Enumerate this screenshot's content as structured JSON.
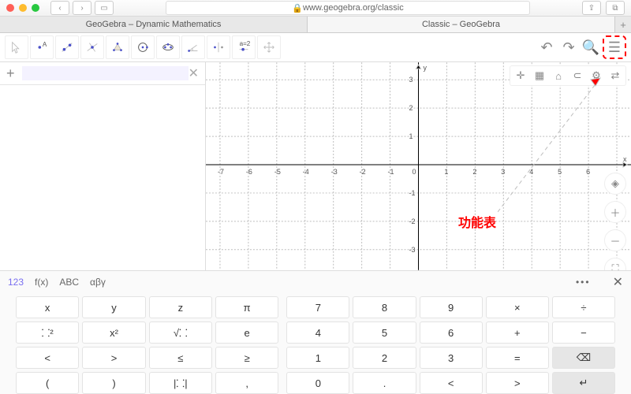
{
  "url": "www.geogebra.org/classic",
  "tabs": [
    "GeoGebra – Dynamic Mathematics",
    "Classic – GeoGebra"
  ],
  "toolbar": [
    "cursor",
    "point",
    "line",
    "perp",
    "poly",
    "circle",
    "ellipse",
    "angle",
    "reflect",
    "slider",
    "move"
  ],
  "right": [
    "undo",
    "redo",
    "search",
    "menu"
  ],
  "input_ph": "",
  "viewbar": [
    "axes",
    "grid",
    "home",
    "snap",
    "settings",
    "style"
  ],
  "zoom": [
    "target",
    "zoom-in",
    "zoom-out",
    "full"
  ],
  "axis": {
    "x": "x",
    "y": "y",
    "xmin": -7,
    "xmax": 6,
    "ymin": -3,
    "ymax": 3
  },
  "annotation": "功能表",
  "kb": {
    "tabs": [
      "123",
      "f(x)",
      "ABC",
      "αβγ"
    ],
    "left": [
      [
        "x",
        "y",
        "z",
        "π"
      ],
      [
        "⸬²",
        "x²",
        "√⸬",
        "e"
      ],
      [
        "<",
        ">",
        "≤",
        "≥"
      ],
      [
        "(",
        ")",
        "|⸬|",
        ","
      ]
    ],
    "mid": [
      [
        "7",
        "8",
        "9",
        "×",
        "÷"
      ],
      [
        "4",
        "5",
        "6",
        "+",
        "−"
      ],
      [
        "1",
        "2",
        "3",
        "=",
        "⌫"
      ],
      [
        "0",
        ".",
        "<",
        ">",
        "↵"
      ]
    ]
  }
}
